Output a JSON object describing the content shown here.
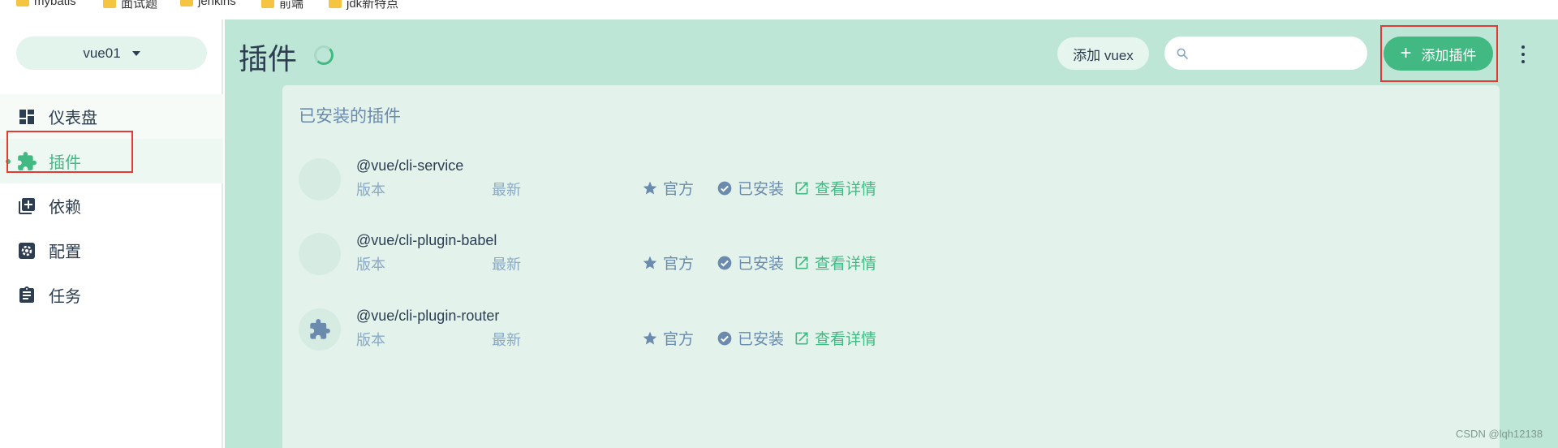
{
  "bookmarks": [
    {
      "label": "mybatis"
    },
    {
      "label": "面试题"
    },
    {
      "label": "jenkins"
    },
    {
      "label": "前端"
    },
    {
      "label": "jdk新特点"
    }
  ],
  "sidebar": {
    "project": "vue01",
    "items": [
      {
        "label": "仪表盘",
        "icon": "dashboard-icon"
      },
      {
        "label": "插件",
        "icon": "puzzle-icon",
        "active": true
      },
      {
        "label": "依赖",
        "icon": "library-books-icon"
      },
      {
        "label": "配置",
        "icon": "settings-icon"
      },
      {
        "label": "任务",
        "icon": "clipboard-icon"
      }
    ]
  },
  "header": {
    "title": "插件",
    "vuex_button": "添加 vuex",
    "search_value": "",
    "add_button": "添加插件"
  },
  "panel": {
    "title": "已安装的插件",
    "plugins": [
      {
        "name": "@vue/cli-service",
        "version_label": "版本",
        "latest_label": "最新",
        "official": "官方",
        "installed": "已安装",
        "details": "查看详情",
        "icon": "blank-avatar"
      },
      {
        "name": "@vue/cli-plugin-babel",
        "version_label": "版本",
        "latest_label": "最新",
        "official": "官方",
        "installed": "已安装",
        "details": "查看详情",
        "icon": "blank-avatar"
      },
      {
        "name": "@vue/cli-plugin-router",
        "version_label": "版本",
        "latest_label": "最新",
        "official": "官方",
        "installed": "已安装",
        "details": "查看详情",
        "icon": "puzzle-icon"
      }
    ]
  },
  "watermark": "CSDN @lqh12138",
  "colors": {
    "accent": "#42b983",
    "main_bg": "#bde6d6",
    "highlight": "#e53935"
  }
}
